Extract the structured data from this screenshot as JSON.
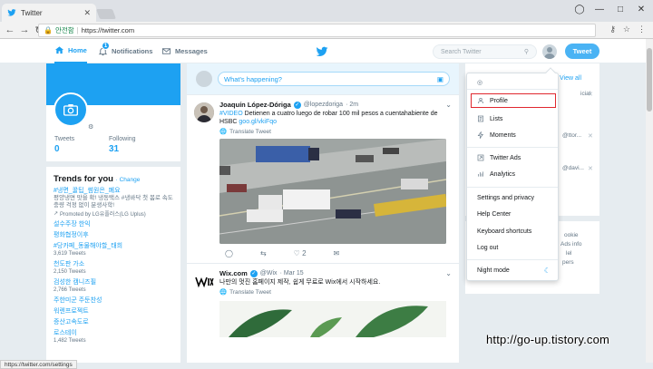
{
  "browser": {
    "tab_title": "Twitter",
    "tab_close": "✕",
    "secure_label": "안전함",
    "url": "https://twitter.com",
    "status_url": "https://twitter.com/settings"
  },
  "header": {
    "nav": [
      {
        "label": "Home"
      },
      {
        "label": "Notifications",
        "badge": "1"
      },
      {
        "label": "Messages"
      }
    ],
    "search_placeholder": "Search Twitter",
    "tweet_button": "Tweet"
  },
  "profile": {
    "tweets_label": "Tweets",
    "tweets_count": "0",
    "following_label": "Following",
    "following_count": "31"
  },
  "trends": {
    "title": "Trends for you",
    "change_label": "· Change",
    "items": [
      {
        "name": "#냉면_꿀팁_썸원은_폐요",
        "desc": "평양냉면 맛을 확! 냉동택스 #냉바닥 첫 봄로 속도 충량 걱정 없이 분생사학!",
        "promoted": "Promoted by LG유플러스(LG Uplus)"
      },
      {
        "name": "설수주장 한익",
        "count": ""
      },
      {
        "name": "평화협정이후",
        "count": ""
      },
      {
        "name": "#당카페_동물해야할_태희",
        "count": "3,619 Tweets"
      },
      {
        "name": "천도판 가소",
        "count": "2,150 Tweets"
      },
      {
        "name": "검성한 캠니즈필",
        "count": "2,766 Tweets"
      },
      {
        "name": "주한미군 주둔찬성",
        "count": ""
      },
      {
        "name": "워렌프로젝트",
        "count": ""
      },
      {
        "name": "증산고속도로",
        "count": ""
      },
      {
        "name": "로스테이",
        "count": "1,482 Tweets"
      }
    ]
  },
  "compose": {
    "placeholder": "What's happening?"
  },
  "tweets": [
    {
      "name": "Joaquín López-Dóriga",
      "handle": "@lopezdoriga",
      "time": "· 2m",
      "text_tag": "#VIDEO",
      "text": " Detienen a cuatro luego de robar 100 mil pesos a cuentahabiente de HSBC ",
      "link": "goo.gl/vkiFqo",
      "translate": "Translate Tweet",
      "retweets": "",
      "likes": "2"
    },
    {
      "name": "Wix.com",
      "handle": "@Wix",
      "time": "· Mar 15",
      "text": "나만의 멋진 홈페이지 제작, 쉽게 무료로 Wix에서 시작하세요.",
      "translate": "Translate Tweet"
    }
  ],
  "right": {
    "view_all": "View all",
    "snippets": [
      "icial",
      "@ttor...",
      "@davi...",
      "ookie",
      "Ads info",
      "lel",
      "pers"
    ]
  },
  "dropdown": {
    "items": [
      {
        "label": "Profile",
        "icon": "person-icon"
      },
      {
        "label": "Lists",
        "icon": "list-icon"
      },
      {
        "label": "Moments",
        "icon": "lightning-icon"
      },
      {
        "label": "Twitter Ads",
        "icon": "ads-icon"
      },
      {
        "label": "Analytics",
        "icon": "analytics-icon"
      },
      {
        "label": "Settings and privacy"
      },
      {
        "label": "Help Center"
      },
      {
        "label": "Keyboard shortcuts"
      },
      {
        "label": "Log out"
      },
      {
        "label": "Night mode"
      }
    ]
  },
  "watermark": "http://go-up.tistory.com",
  "colors": {
    "accent": "#1da1f2",
    "highlight": "#e0282f"
  }
}
